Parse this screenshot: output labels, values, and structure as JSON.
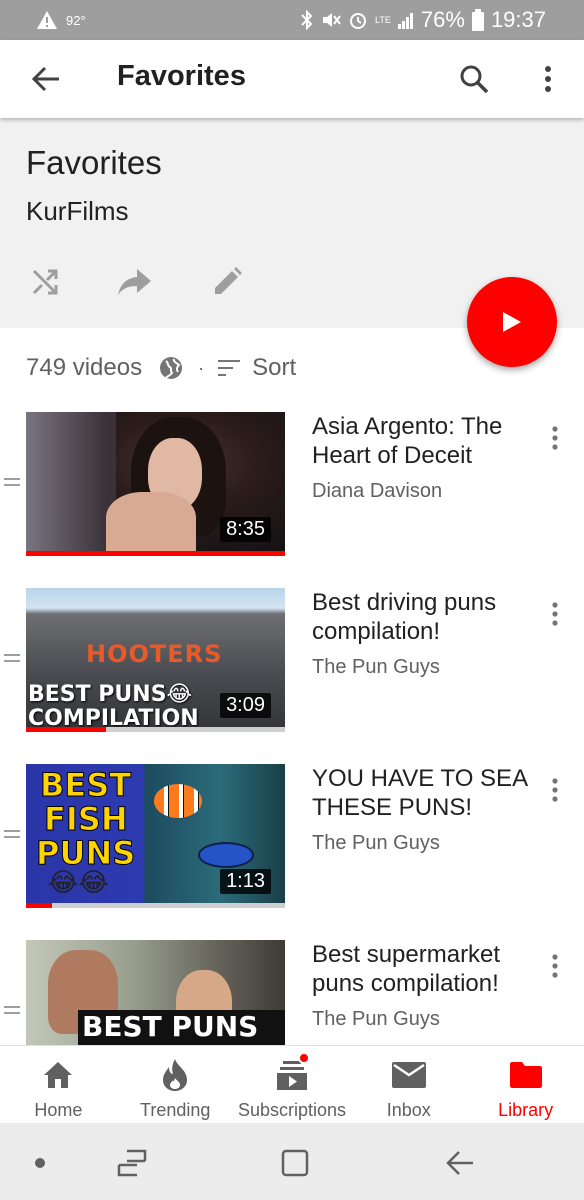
{
  "status_bar": {
    "temperature": "92°",
    "battery": "76%",
    "time": "19:37",
    "network": "LTE"
  },
  "app_bar": {
    "title": "Favorites",
    "icons": [
      "arrow-back-icon",
      "search-icon",
      "more-vert-icon"
    ]
  },
  "playlist": {
    "title": "Favorites",
    "channel": "KurFilms",
    "actions": [
      "shuffle-icon",
      "share-icon",
      "edit-icon"
    ],
    "video_count": "749 videos",
    "sort_label": "Sort",
    "meta_separator": "·"
  },
  "videos": [
    {
      "title": "Asia Argento: The Heart of Deceit",
      "channel": "Diana Davison",
      "duration": "8:35",
      "watched_fraction": 1.0
    },
    {
      "title": "Best driving puns compilation!",
      "channel": "The Pun Guys",
      "duration": "3:09",
      "watched_fraction": 0.31,
      "thumb_text": [
        "HOOTERS",
        "BEST PUNS😂",
        "COMPILATION"
      ]
    },
    {
      "title": "YOU HAVE TO SEA THESE PUNS!",
      "channel": "The Pun Guys",
      "duration": "1:13",
      "watched_fraction": 0.1,
      "thumb_text": [
        "BEST",
        "FISH",
        "PUNS",
        "😂😂"
      ]
    },
    {
      "title": "Best supermarket puns compilation!",
      "channel": "The Pun Guys",
      "duration": "",
      "watched_fraction": 0,
      "thumb_text": [
        "BEST PUNS😂"
      ]
    }
  ],
  "bottom_nav": {
    "items": [
      {
        "label": "Home",
        "icon": "home-icon"
      },
      {
        "label": "Trending",
        "icon": "flame-icon"
      },
      {
        "label": "Subscriptions",
        "icon": "subscriptions-icon"
      },
      {
        "label": "Inbox",
        "icon": "mail-icon"
      },
      {
        "label": "Library",
        "icon": "folder-icon"
      }
    ],
    "active": "Library"
  },
  "colors": {
    "accent": "#ff0000",
    "status_bar": "#9e9e9e",
    "header_bg": "#f1f1f1"
  }
}
